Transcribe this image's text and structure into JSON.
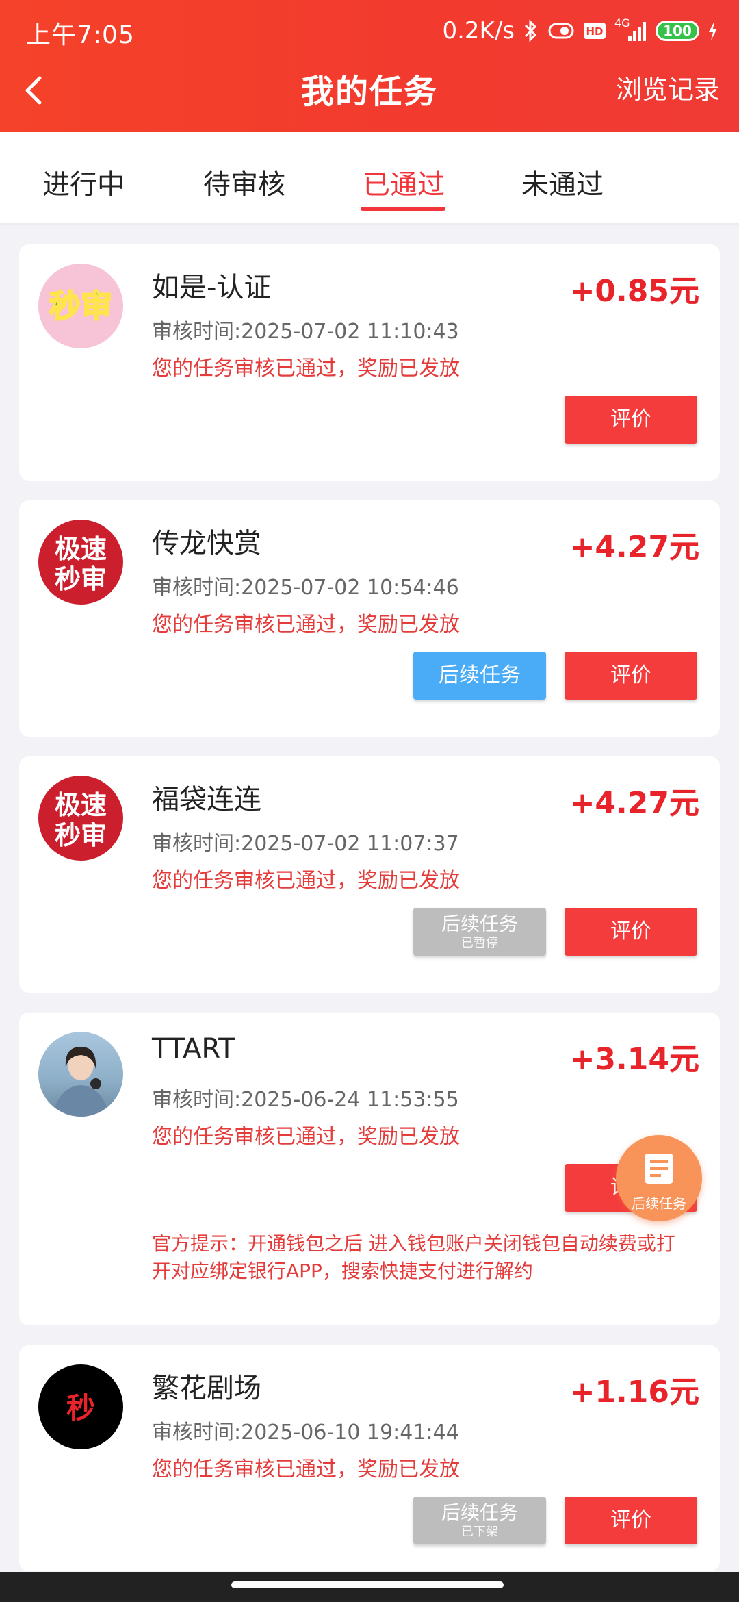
{
  "status_bar": {
    "time": "上午7:05",
    "speed": "0.2K/s",
    "network": "4G",
    "battery": "100"
  },
  "nav": {
    "title": "我的任务",
    "history": "浏览记录"
  },
  "tabs": [
    {
      "label": "进行中"
    },
    {
      "label": "待审核"
    },
    {
      "label": "已通过"
    },
    {
      "label": "未通过"
    }
  ],
  "active_tab": "已通过",
  "tasks": [
    {
      "name": "如是-认证",
      "amount": "+0.85元",
      "review_time": "审核时间:2025-07-02 11:10:43",
      "status": "您的任务审核已通过，奖励已发放",
      "avatar": {
        "type": "text-logo",
        "text1": "秒审",
        "bg": "#f7c3d6",
        "color": "#39b341"
      },
      "follow_button": null,
      "rate_label": "评价"
    },
    {
      "name": "传龙快赏",
      "amount": "+4.27元",
      "review_time": "审核时间:2025-07-02 10:54:46",
      "status": "您的任务审核已通过，奖励已发放",
      "avatar": {
        "type": "text-logo",
        "text1": "极速",
        "text2": "秒审",
        "bg": "#cc1f2e",
        "color": "#ffffff"
      },
      "follow_button": {
        "label": "后续任务",
        "sub": "",
        "color": "#4aabf6"
      },
      "rate_label": "评价"
    },
    {
      "name": "福袋连连",
      "amount": "+4.27元",
      "review_time": "审核时间:2025-07-02 11:07:37",
      "status": "您的任务审核已通过，奖励已发放",
      "avatar": {
        "type": "text-logo",
        "text1": "极速",
        "text2": "秒审",
        "bg": "#cc1f2e",
        "color": "#ffffff"
      },
      "follow_button": {
        "label": "后续任务",
        "sub": "已暂停",
        "color": "#bdbdbd"
      },
      "rate_label": "评价"
    },
    {
      "name": "TTART",
      "amount": "+3.14元",
      "review_time": "审核时间:2025-06-24 11:53:55",
      "status": "您的任务审核已通过，奖励已发放",
      "avatar": {
        "type": "photo"
      },
      "follow_button": null,
      "rate_label": "评价",
      "tip": "官方提示：开通钱包之后 进入钱包账户关闭钱包自动续费或打开对应绑定银行APP，搜索快捷支付进行解约"
    },
    {
      "name": "繁花剧场",
      "amount": "+1.16元",
      "review_time": "审核时间:2025-06-10 19:41:44",
      "status": "您的任务审核已通过，奖励已发放",
      "avatar": {
        "type": "text-logo",
        "text1": "秒",
        "bg": "#000000",
        "color": "#e8232a"
      },
      "follow_button": {
        "label": "后续任务",
        "sub": "已下架",
        "color": "#bdbdbd"
      },
      "rate_label": "评价"
    }
  ],
  "floating_button": {
    "label": "后续任务",
    "icon": "list-icon"
  }
}
